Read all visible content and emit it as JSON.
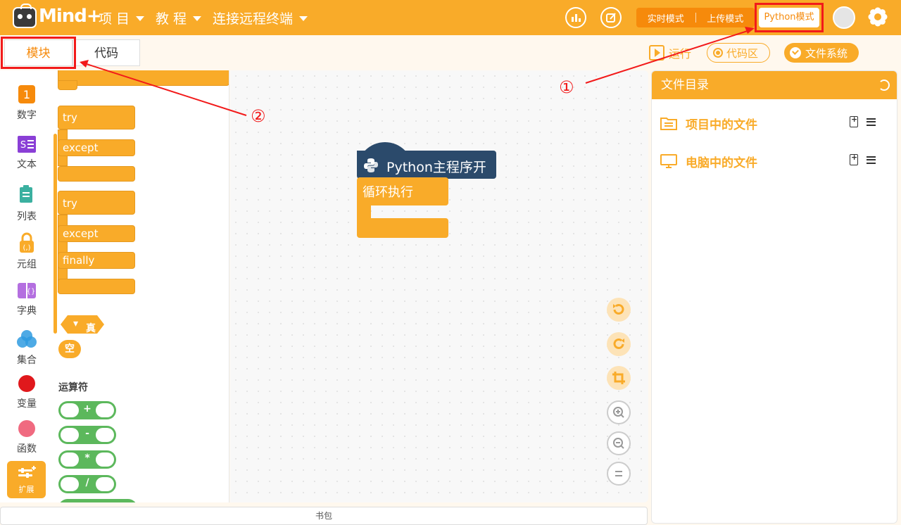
{
  "app": {
    "logo_text": "Mind+"
  },
  "topbar": {
    "menus": [
      {
        "label": "项 目"
      },
      {
        "label": "教 程"
      },
      {
        "label": "连接远程终端"
      }
    ],
    "mode_realtime": "实时模式",
    "mode_upload": "上传模式",
    "mode_python": "Python模式"
  },
  "tabs": {
    "blocks": "模块",
    "code": "代码"
  },
  "toolbar": {
    "run": "运行",
    "code_area": "代码区",
    "file_system": "文件系统"
  },
  "categories": [
    {
      "label": "数字",
      "color": "#f68a0b",
      "icon": "number-icon"
    },
    {
      "label": "文本",
      "color": "#8a3fd6",
      "icon": "text-icon"
    },
    {
      "label": "列表",
      "color": "#3bb0a0",
      "icon": "list-icon"
    },
    {
      "label": "元组",
      "color": "#f9ab29",
      "icon": "tuple-icon"
    },
    {
      "label": "字典",
      "color": "#b46fe0",
      "icon": "dict-icon"
    },
    {
      "label": "集合",
      "color": "#2f9be0",
      "icon": "set-icon"
    },
    {
      "label": "变量",
      "color": "#e0181c",
      "icon": "variable-icon"
    },
    {
      "label": "函数",
      "color": "#f06a80",
      "icon": "function-icon"
    }
  ],
  "extension_label": "扩展",
  "palette": {
    "try1": {
      "try": "try",
      "except": "except"
    },
    "try2": {
      "try": "try",
      "except": "except",
      "finally": "finally"
    },
    "bool_true": "真",
    "null_value": "空",
    "operators_title": "运算符",
    "operators": [
      "+",
      "-",
      "*",
      "/"
    ]
  },
  "workspace": {
    "hat_label": "Python主程序开始",
    "loop_label": "循环执行"
  },
  "file_panel": {
    "title": "文件目录",
    "project_files": "项目中的文件",
    "computer_files": "电脑中的文件"
  },
  "backpack_label": "书包",
  "annotations": {
    "num1": "①",
    "num2": "②"
  },
  "colors": {
    "brand_orange": "#f9ab29",
    "accent_orange": "#f68a0b",
    "hat_navy": "#2b4a6b",
    "operator_green": "#5cb85c",
    "annotation_red": "#f21a1a"
  }
}
